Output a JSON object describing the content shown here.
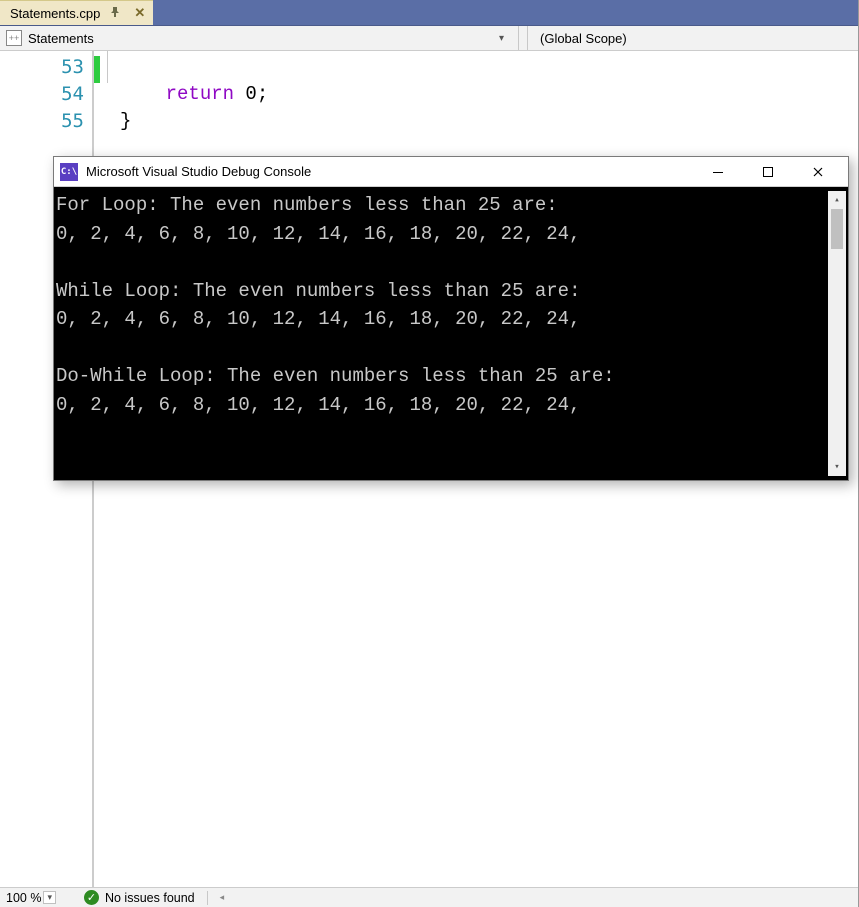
{
  "tab": {
    "filename": "Statements.cpp"
  },
  "nav": {
    "class_name": "Statements",
    "scope_label": "(Global Scope)"
  },
  "editor": {
    "lines": [
      {
        "n": "53",
        "text": ""
      },
      {
        "n": "54",
        "text_pre": "    ",
        "return_kw": "return",
        "after": " 0;"
      },
      {
        "n": "55",
        "text": "}"
      }
    ]
  },
  "console": {
    "title": "Microsoft Visual Studio Debug Console",
    "output": "For Loop: The even numbers less than 25 are:\n0, 2, 4, 6, 8, 10, 12, 14, 16, 18, 20, 22, 24,\n\nWhile Loop: The even numbers less than 25 are:\n0, 2, 4, 6, 8, 10, 12, 14, 16, 18, 20, 22, 24,\n\nDo-While Loop: The even numbers less than 25 are:\n0, 2, 4, 6, 8, 10, 12, 14, 16, 18, 20, 22, 24,"
  },
  "status": {
    "zoom": "100 %",
    "issues": "No issues found"
  }
}
